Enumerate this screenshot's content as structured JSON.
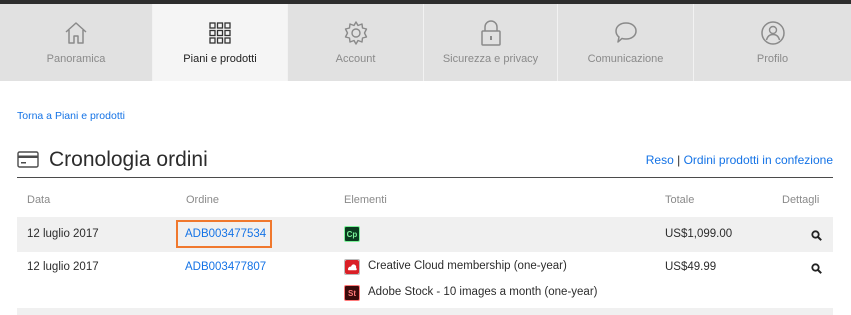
{
  "nav": {
    "tabs": [
      {
        "label": "Panoramica",
        "icon": "home-icon",
        "active": false
      },
      {
        "label": "Piani e prodotti",
        "icon": "grid-icon",
        "active": true
      },
      {
        "label": "Account",
        "icon": "gear-icon",
        "active": false
      },
      {
        "label": "Sicurezza e privacy",
        "icon": "lock-icon",
        "active": false
      },
      {
        "label": "Comunicazione",
        "icon": "chat-bubble-icon",
        "active": false
      },
      {
        "label": "Profilo",
        "icon": "profile-icon",
        "active": false
      }
    ]
  },
  "back_link": "Torna a Piani e prodotti",
  "section": {
    "icon": "credit-card-icon",
    "title": "Cronologia ordini",
    "links": {
      "returns": "Reso",
      "separator": "|",
      "bundled": "Ordini prodotti in confezione"
    }
  },
  "table": {
    "headers": {
      "date": "Data",
      "order": "Ordine",
      "items": "Elementi",
      "total": "Totale",
      "details": "Dettagli"
    },
    "rows": [
      {
        "date": "12 luglio 2017",
        "order": "ADB003477534",
        "items": [
          {
            "icon_label": "Cp",
            "icon": "adobe-captivate-icon",
            "name": ""
          }
        ],
        "total": "US$1,099.00",
        "details_icon": "magnifier-icon"
      },
      {
        "date": "12 luglio 2017",
        "order": "ADB003477807",
        "items": [
          {
            "icon": "creative-cloud-icon",
            "name": "Creative Cloud membership (one-year)"
          },
          {
            "icon_label": "St",
            "icon": "adobe-stock-icon",
            "name": "Adobe Stock - 10 images a month (one-year)"
          }
        ],
        "total": "US$49.99",
        "details_icon": "magnifier-icon"
      }
    ]
  },
  "colors": {
    "link": "#1473e6",
    "highlight": "#f0782d",
    "tab_bg": "#e1e1e1",
    "captivate_bg": "#0a3b1e",
    "captivate_fg": "#7df29a",
    "stock_bg": "#3b0a0a",
    "stock_fg": "#ff7a7a",
    "cc_bg": "#da1f26"
  }
}
